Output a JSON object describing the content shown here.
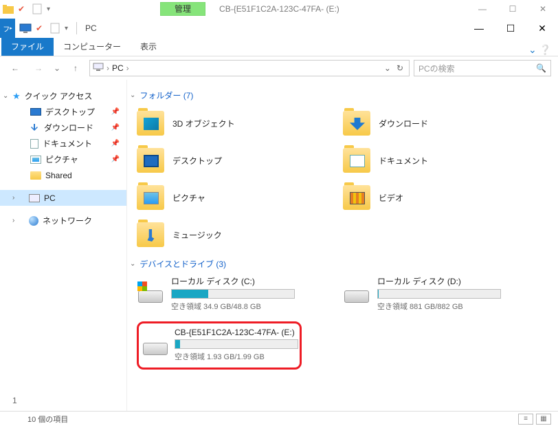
{
  "titlebar1": {
    "manage": "管理",
    "title": "CB-{E51F1C2A-123C-47FA- (E:)"
  },
  "titlebar2": {
    "pc_label": "PC"
  },
  "ribbon": {
    "file": "ファイル",
    "computer": "コンピューター",
    "view": "表示"
  },
  "address": {
    "crumb": "PC",
    "search_placeholder": "PCの検索"
  },
  "nav": {
    "quick": "クイック アクセス",
    "desktop": "デスクトップ",
    "downloads": "ダウンロード",
    "documents": "ドキュメント",
    "pictures": "ピクチャ",
    "shared": "Shared",
    "pc": "PC",
    "network": "ネットワーク"
  },
  "groups": {
    "folders_hdr": "フォルダー (7)",
    "drives_hdr": "デバイスとドライブ (3)"
  },
  "folders": {
    "f3d": "3D オブジェクト",
    "dl": "ダウンロード",
    "desk": "デスクトップ",
    "doc": "ドキュメント",
    "pic": "ピクチャ",
    "vid": "ビデオ",
    "mus": "ミュージック"
  },
  "drives": {
    "c": {
      "name": "ローカル ディスク (C:)",
      "free": "空き領域 34.9 GB/48.8 GB",
      "pct": "30%"
    },
    "d": {
      "name": "ローカル ディスク (D:)",
      "free": "空き領域 881 GB/882 GB",
      "pct": "0.5%"
    },
    "e": {
      "name": "CB-{E51F1C2A-123C-47FA- (E:)",
      "free": "空き領域 1.93 GB/1.99 GB",
      "pct": "4%"
    }
  },
  "status": {
    "page": "1",
    "items": "10 個の項目"
  }
}
